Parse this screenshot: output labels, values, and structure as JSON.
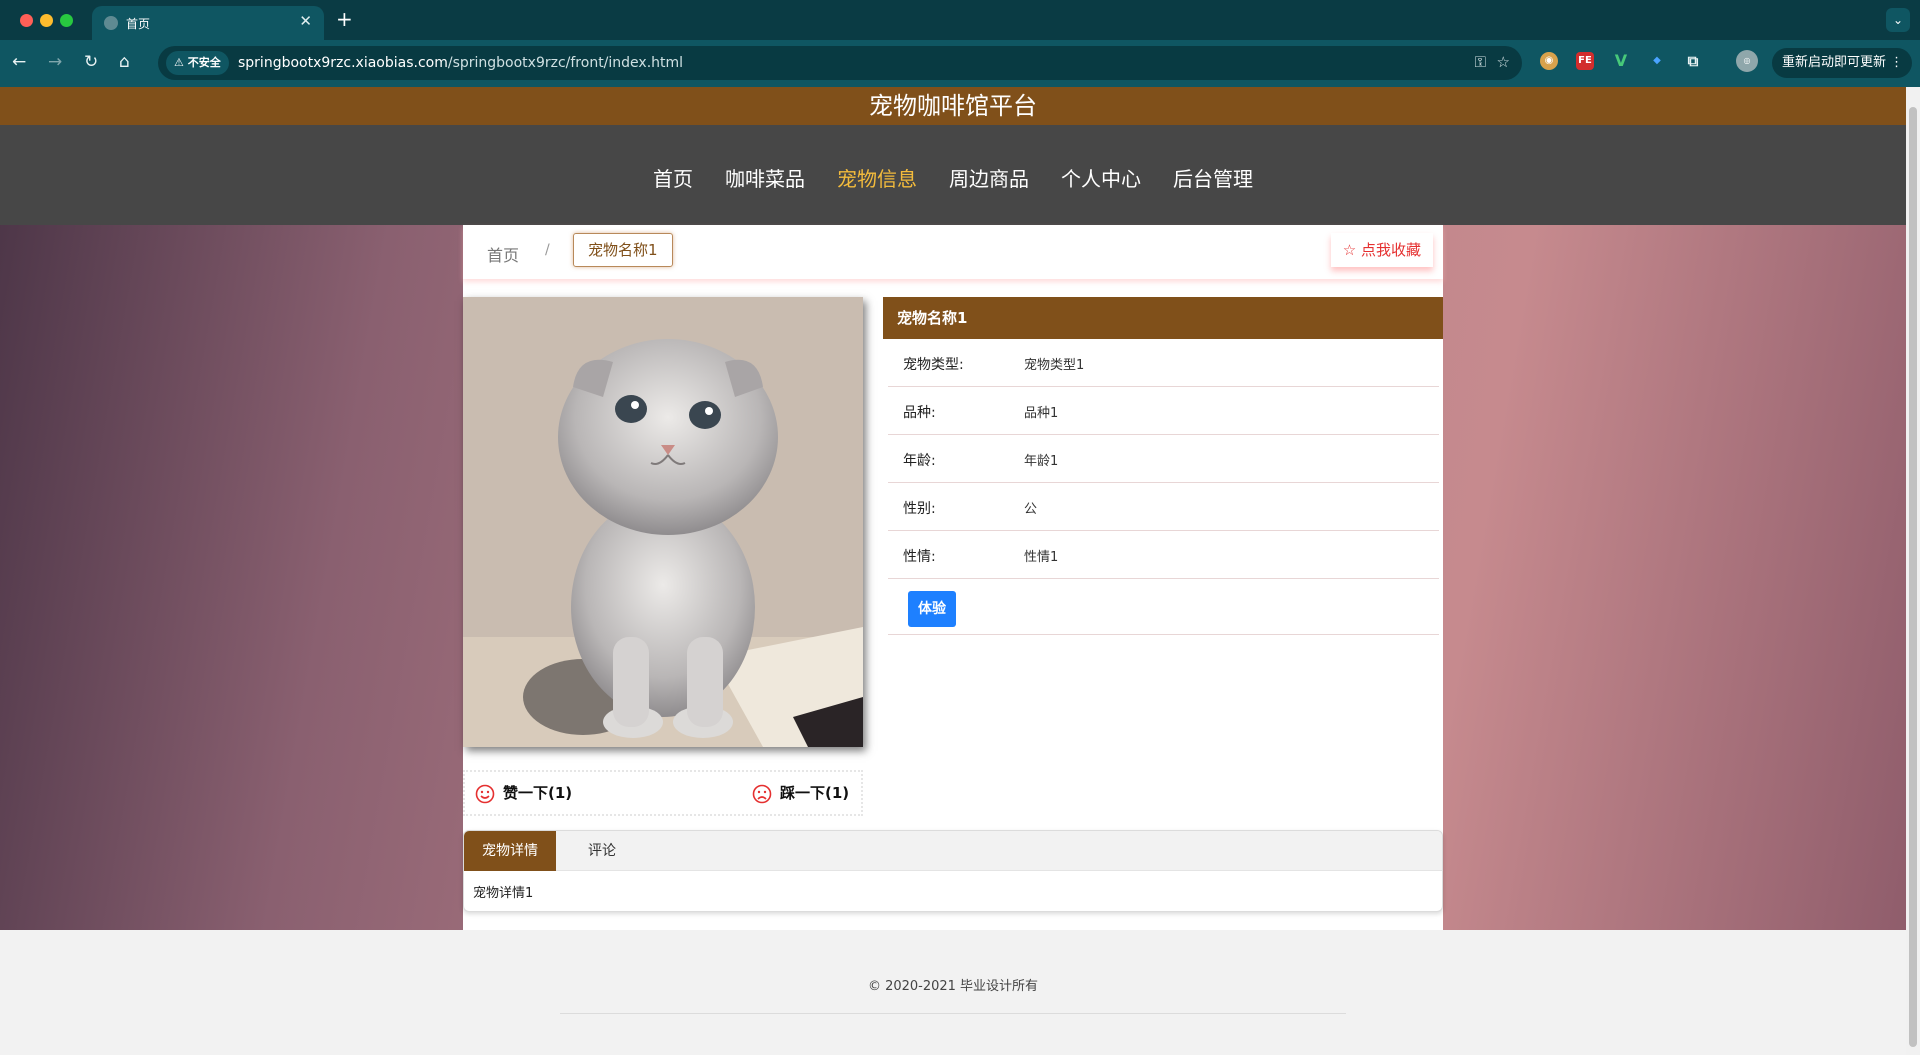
{
  "browser": {
    "tab_title": "首页",
    "new_tab_symbol": "+",
    "tab_close_symbol": "✕",
    "tab_menu_symbol": "⌄",
    "security_label": "⚠ 不安全",
    "url_host": "springbootx9rzc.xiaobias.com",
    "url_path": "/springbootx9rzc/front/index.html",
    "update_button": "重新启动即可更新 ⋮",
    "icons": [
      "back-icon",
      "forward-icon",
      "reload-icon",
      "home-icon",
      "key-icon",
      "star-icon",
      "extension-icon",
      "profile-avatar"
    ]
  },
  "site": {
    "title": "宠物咖啡馆平台",
    "menu": [
      {
        "label": "首页",
        "active": false
      },
      {
        "label": "咖啡菜品",
        "active": false
      },
      {
        "label": "宠物信息",
        "active": true
      },
      {
        "label": "周边商品",
        "active": false
      },
      {
        "label": "个人中心",
        "active": false
      },
      {
        "label": "后台管理",
        "active": false
      }
    ],
    "accent_color": "#80501a",
    "active_menu_color": "#f3bb3c",
    "menu_bg": "#474747"
  },
  "breadcrumb": {
    "home": "首页",
    "separator": "/",
    "current": "宠物名称1"
  },
  "favorite_button": "☆ 点我收藏",
  "pet": {
    "name": "宠物名称1",
    "fields": [
      {
        "label": "宠物类型:",
        "value": "宠物类型1"
      },
      {
        "label": "品种:",
        "value": "品种1"
      },
      {
        "label": "年龄:",
        "value": "年龄1"
      },
      {
        "label": "性别:",
        "value": "公"
      },
      {
        "label": "性情:",
        "value": "性情1"
      }
    ],
    "experience_button": "体验",
    "photo_icon": "kitten-photo"
  },
  "votes": {
    "like": "赞一下(1)",
    "dislike": "踩一下(1)",
    "like_icon": "smile-icon",
    "dislike_icon": "frown-icon",
    "icon_color": "#e53030"
  },
  "tabs": {
    "detail_label": "宠物详情",
    "comment_label": "评论",
    "detail_content": "宠物详情1"
  },
  "footer": {
    "copyright": "© 2020-2021 毕业设计所有"
  }
}
